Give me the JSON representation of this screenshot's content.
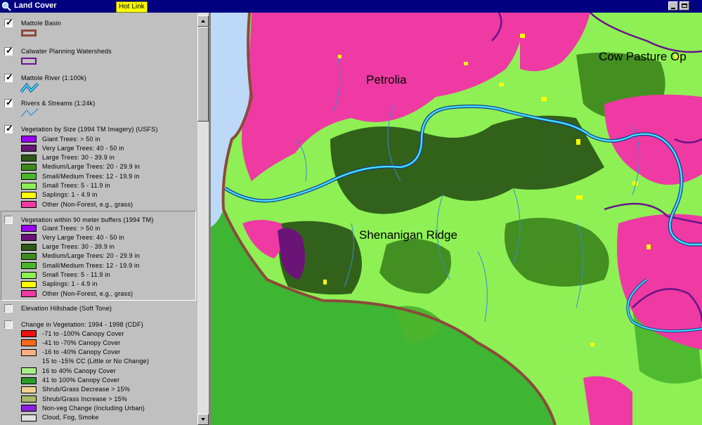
{
  "window": {
    "title": "Land Cover",
    "hot_link_label": "Hot Link"
  },
  "colors": {
    "giant": "#9900ee",
    "very_large": "#6a1478",
    "large": "#2d5a17",
    "medium_large": "#3f8a1f",
    "small_medium": "#4cb52e",
    "small": "#8ef055",
    "saplings": "#ffff00",
    "other": "#ee3aa2",
    "ocean": "#bdd9f7",
    "basin_outline": "#8b4a3a",
    "watershed": "#6a148a",
    "river": "#40e0ff",
    "streams": "#3a8ad6"
  },
  "toc": {
    "mattole_basin": {
      "name": "Mattole Basin",
      "checked": true,
      "symbol_icon": "basin-outline-icon"
    },
    "calwater": {
      "name": "Calwater Planning Watersheds",
      "checked": true,
      "symbol_icon": "watershed-outline-icon"
    },
    "mattole_river": {
      "name": "Mattole River (1:100k)",
      "checked": true,
      "symbol_icon": "river-line-icon"
    },
    "rivers_streams": {
      "name": "Rivers & Streams (1:24k)",
      "checked": true,
      "symbol_icon": "stream-line-icon"
    },
    "veg_size": {
      "name": "Vegetation by Size (1994 TM Imagery) (USFS)",
      "checked": true,
      "classes": [
        {
          "label": "Giant Trees: > 50 in",
          "color": "#9900ee"
        },
        {
          "label": "Very Large Trees: 40 - 50 in",
          "color": "#6a1478"
        },
        {
          "label": "Large Trees: 30 - 39.9 in",
          "color": "#2d5a17"
        },
        {
          "label": "Medium/Large Trees: 20 - 29.9 in",
          "color": "#3f8a1f"
        },
        {
          "label": "Small/Medium Trees: 12 - 19.9 in",
          "color": "#4cb52e"
        },
        {
          "label": "Small Trees: 5 - 11.9 in",
          "color": "#8ef055"
        },
        {
          "label": "Saplings: 1 - 4.9 in",
          "color": "#ffff00"
        },
        {
          "label": "Other (Non-Forest, e.g., grass)",
          "color": "#ee3aa2"
        }
      ]
    },
    "veg_buffers": {
      "name": "Vegetation within 90 meter buffers (1994 TM)",
      "checked": false,
      "classes": [
        {
          "label": "Giant Trees: > 50 in",
          "color": "#9900ee"
        },
        {
          "label": "Very Large Trees: 40 - 50 in",
          "color": "#6a1478"
        },
        {
          "label": "Large Trees: 30 - 39.9 in",
          "color": "#2d5a17"
        },
        {
          "label": "Medium/Large Trees: 20 - 29.9 in",
          "color": "#3f8a1f"
        },
        {
          "label": "Small/Medium Trees: 12 - 19.9 in",
          "color": "#4cb52e"
        },
        {
          "label": "Small Trees: 5 - 11.9 in",
          "color": "#8ef055"
        },
        {
          "label": "Saplings: 1 - 4.9 in",
          "color": "#ffff00"
        },
        {
          "label": "Other (Non-Forest, e.g., grass)",
          "color": "#ee3aa2"
        }
      ]
    },
    "hillshade": {
      "name": "Elevation Hillshade (Soft Tone)",
      "checked": false
    },
    "change": {
      "name": "Change in Vegetation: 1994 - 1998 (CDF)",
      "checked": false,
      "classes": [
        {
          "label": "-71 to -100% Canopy Cover",
          "color": "#ee1111"
        },
        {
          "label": "-41 to -70% Canopy Cover",
          "color": "#ff6a1a"
        },
        {
          "label": "-16 to -40% Canopy Cover",
          "color": "#f8b080"
        },
        {
          "label": "15 to -15% CC (Little or No Change)",
          "color": ""
        },
        {
          "label": "16 to 40% Canopy Cover",
          "color": "#a8f088"
        },
        {
          "label": "41 to 100% Canopy Cover",
          "color": "#2a9a2a"
        },
        {
          "label": "Shrub/Grass Decrease > 15%",
          "color": "#f0d090"
        },
        {
          "label": "Shrub/Grass Increase > 15%",
          "color": "#a8b868"
        },
        {
          "label": "Non-veg Change (Including Urban)",
          "color": "#8a22dd"
        },
        {
          "label": "Cloud, Fog, Smoke",
          "color": "#e0e0e0"
        }
      ]
    }
  },
  "map": {
    "places": [
      {
        "name": "Petrolia"
      },
      {
        "name": "Cow Pasture Op"
      },
      {
        "name": "Shenanigan Ridge"
      }
    ]
  }
}
